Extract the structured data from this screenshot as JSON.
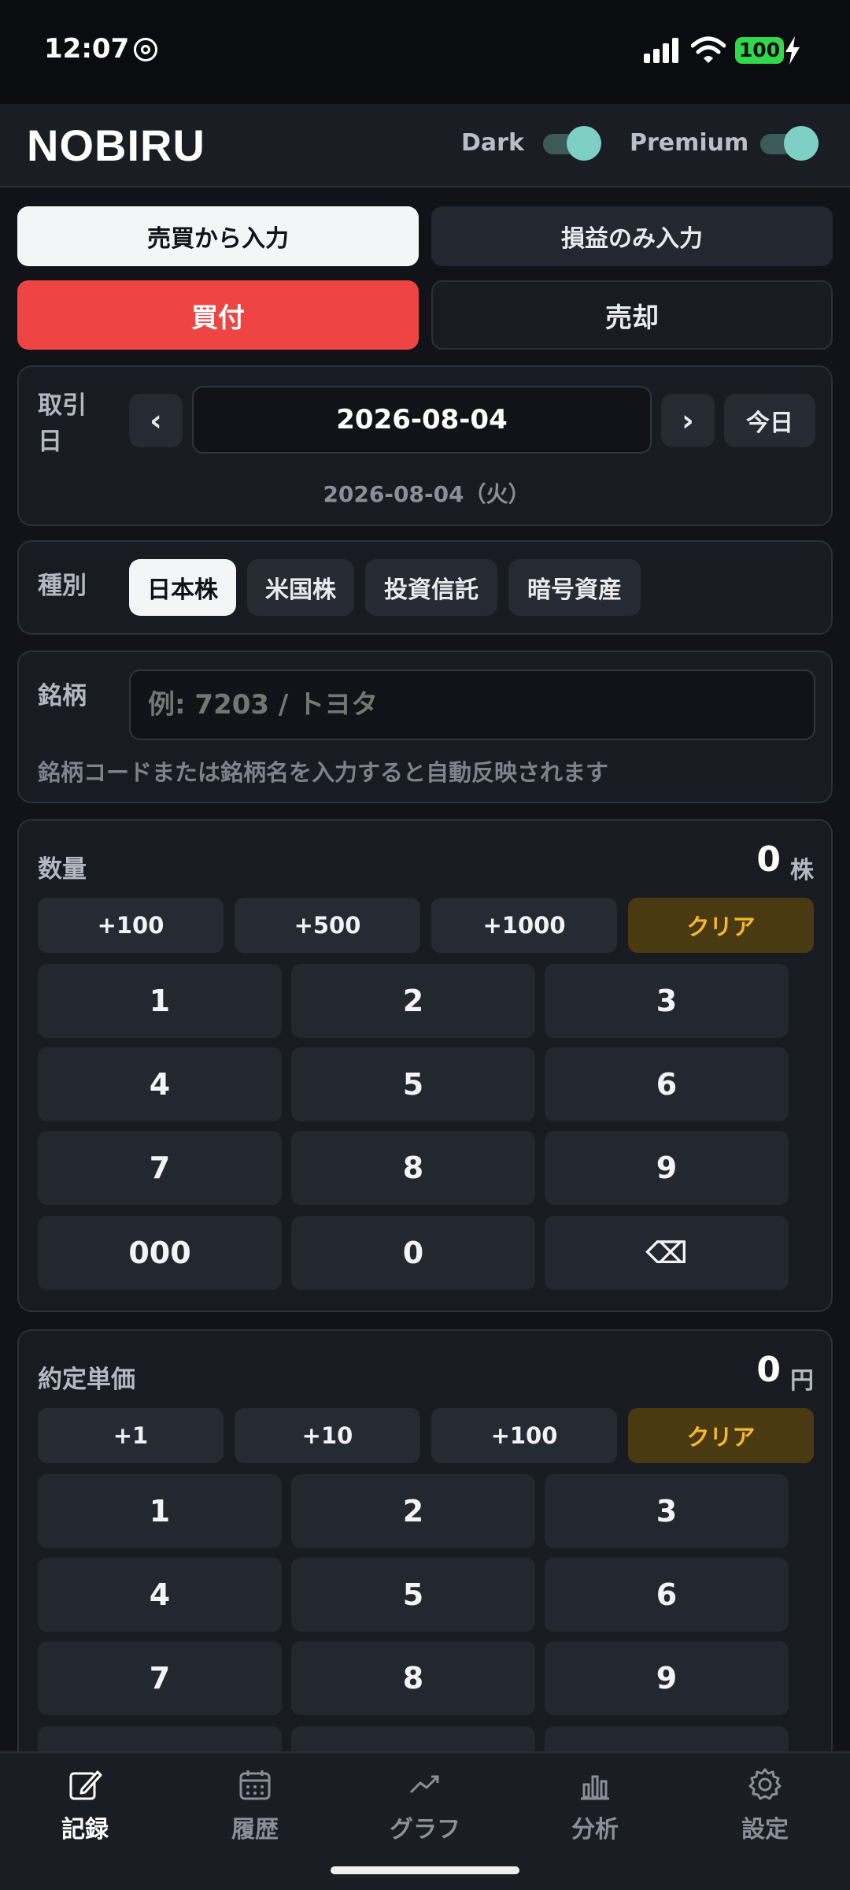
{
  "status": {
    "time": "12:07",
    "battery": "100"
  },
  "header": {
    "logo": "NOBIRU",
    "dark_label": "Dark",
    "premium_label": "Premium"
  },
  "mode_tabs": {
    "trade": "売買から入力",
    "pnl": "損益のみ入力"
  },
  "side_tabs": {
    "buy": "買付",
    "sell": "売却"
  },
  "date": {
    "label": "取引日",
    "value": "2026-08-04",
    "sub": "2026-08-04（火）",
    "prev": "‹",
    "next": "›",
    "today": "今日"
  },
  "category": {
    "label": "種別",
    "options": [
      "日本株",
      "米国株",
      "投資信託",
      "暗号資産"
    ]
  },
  "symbol": {
    "label": "銘柄",
    "placeholder": "例: 7203 / トヨタ",
    "hint": "銘柄コードまたは銘柄名を入力すると自動反映されます"
  },
  "quantity": {
    "label": "数量",
    "value": "0",
    "unit": "株",
    "quick": [
      "+100",
      "+500",
      "+1000"
    ],
    "clear": "クリア",
    "keys": [
      "1",
      "2",
      "3",
      "4",
      "5",
      "6",
      "7",
      "8",
      "9",
      "000",
      "0",
      "⌫"
    ]
  },
  "price": {
    "label": "約定単価",
    "value": "0",
    "unit": "円",
    "quick": [
      "+1",
      "+10",
      "+100"
    ],
    "clear": "クリア",
    "keys": [
      "1",
      "2",
      "3",
      "4",
      "5",
      "6",
      "7",
      "8",
      "9"
    ]
  },
  "tabs": [
    {
      "label": "記録",
      "icon": "edit-icon"
    },
    {
      "label": "履歴",
      "icon": "calendar-icon"
    },
    {
      "label": "グラフ",
      "icon": "trend-icon"
    },
    {
      "label": "分析",
      "icon": "bar-chart-icon"
    },
    {
      "label": "設定",
      "icon": "gear-icon"
    }
  ],
  "colors": {
    "buy": "#ef4444",
    "clear_text": "#f5b82e",
    "accent_toggle": "#7fd0c4"
  }
}
